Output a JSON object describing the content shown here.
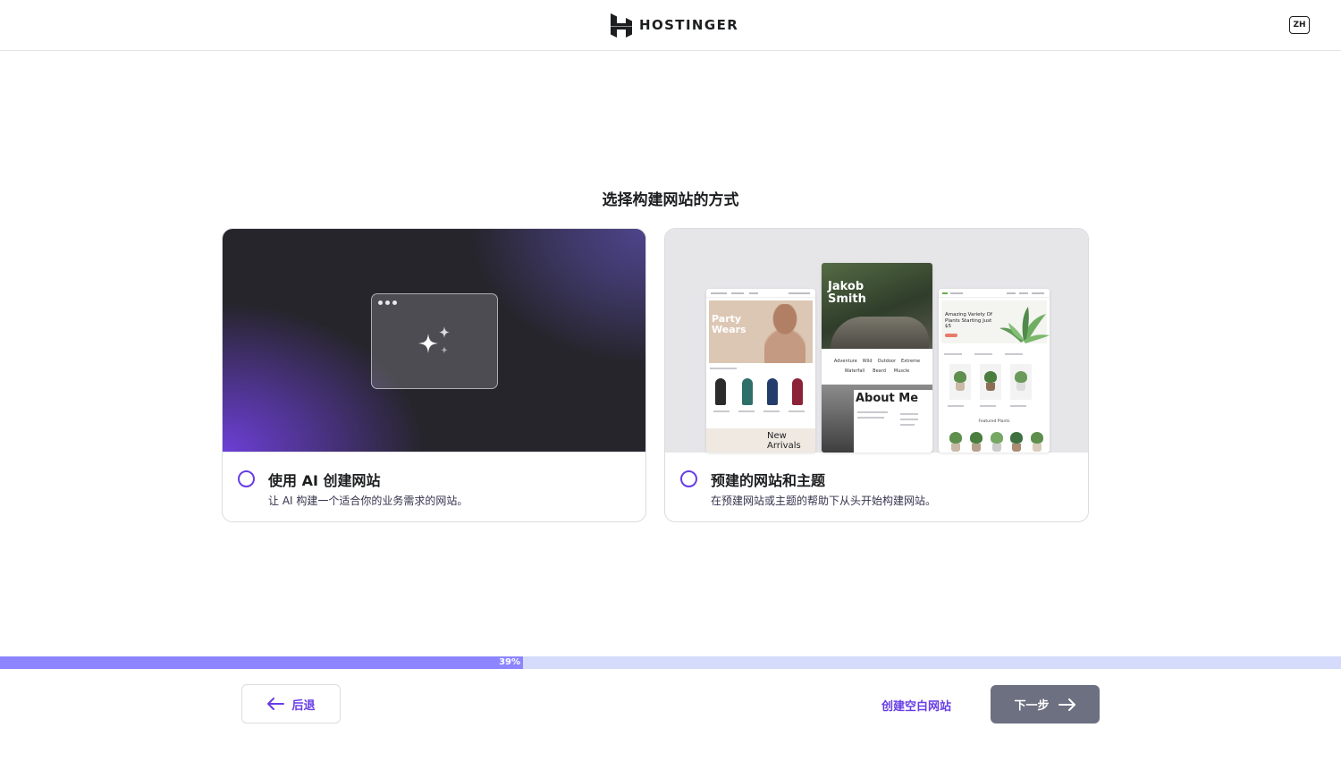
{
  "header": {
    "brand": "HOSTINGER",
    "language": "ZH",
    "logo_icon": "hostinger-logo-icon"
  },
  "main": {
    "title": "选择构建网站的方式",
    "options": [
      {
        "name": "使用 AI 创建网站",
        "description": "让 AI 构建一个适合你的业务需求的网站。",
        "selected": false,
        "icon": "sparkle-icon"
      },
      {
        "name": "预建的网站和主题",
        "description": "在预建网站或主题的帮助下从头开始构建网站。",
        "selected": false,
        "previews": {
          "left": {
            "headline_1": "Party",
            "headline_2": "Wears",
            "footer_1": "New",
            "footer_2": "Arrivals"
          },
          "middle": {
            "headline_1": "Jakob",
            "headline_2": "Smith",
            "categories_row_1": [
              "Adventure",
              "Wild",
              "Outdoor",
              "Extreme"
            ],
            "categories_row_2": [
              "Waterfall",
              "Beard",
              "Muscle"
            ],
            "section": "About Me"
          },
          "right": {
            "headline": "Amazing Variety Of Plants Starting Just $5",
            "section": "Featured Plants"
          }
        }
      }
    ]
  },
  "progress": {
    "value": 0.39,
    "label": "39%"
  },
  "footer": {
    "back_label": "后退",
    "blank_site_label": "创建空白网站",
    "next_label": "下一步"
  },
  "colors": {
    "accent": "#673de6",
    "progress_fill": "#8c85ff",
    "progress_track": "#d5dbfb",
    "next_button": "#6d7081"
  }
}
